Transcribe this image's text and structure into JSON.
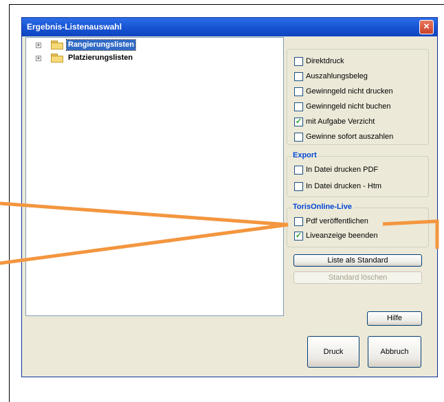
{
  "window": {
    "title": "Ergebnis-Listenauswahl",
    "close_glyph": "×"
  },
  "tree": {
    "items": [
      {
        "label": "Rangierungslisten",
        "expander": "+",
        "selected": true
      },
      {
        "label": "Platzierungslisten",
        "expander": "+",
        "selected": false
      }
    ]
  },
  "options": {
    "items": [
      {
        "label": "Direktdruck",
        "mark": ""
      },
      {
        "label": "Auszahlungsbeleg",
        "mark": ""
      },
      {
        "label": "Gewinngeld nicht drucken",
        "mark": ""
      },
      {
        "label": "Gewinngeld nicht buchen",
        "mark": ""
      },
      {
        "label": "mit Aufgabe Verzicht",
        "mark": "✓"
      },
      {
        "label": "Gewinne sofort auszahlen",
        "mark": ""
      }
    ]
  },
  "export": {
    "title": "Export",
    "items": [
      {
        "label": "In Datei drucken PDF",
        "mark": ""
      },
      {
        "label": "In Datei drucken - Htm",
        "mark": ""
      }
    ]
  },
  "live": {
    "title": "TorisOnline-Live",
    "items": [
      {
        "label": "Pdf veröffentlichen",
        "mark": ""
      },
      {
        "label": "Liveanzeige beenden",
        "mark": "✓"
      }
    ]
  },
  "buttons": {
    "standard": "Liste als Standard",
    "delete_standard": "Standard löschen",
    "help": "Hilfe",
    "print": "Druck",
    "cancel": "Abbruch"
  },
  "colors": {
    "callout": "#f3963f",
    "title_bar": "#1754d4",
    "group_title": "#0046d5"
  }
}
